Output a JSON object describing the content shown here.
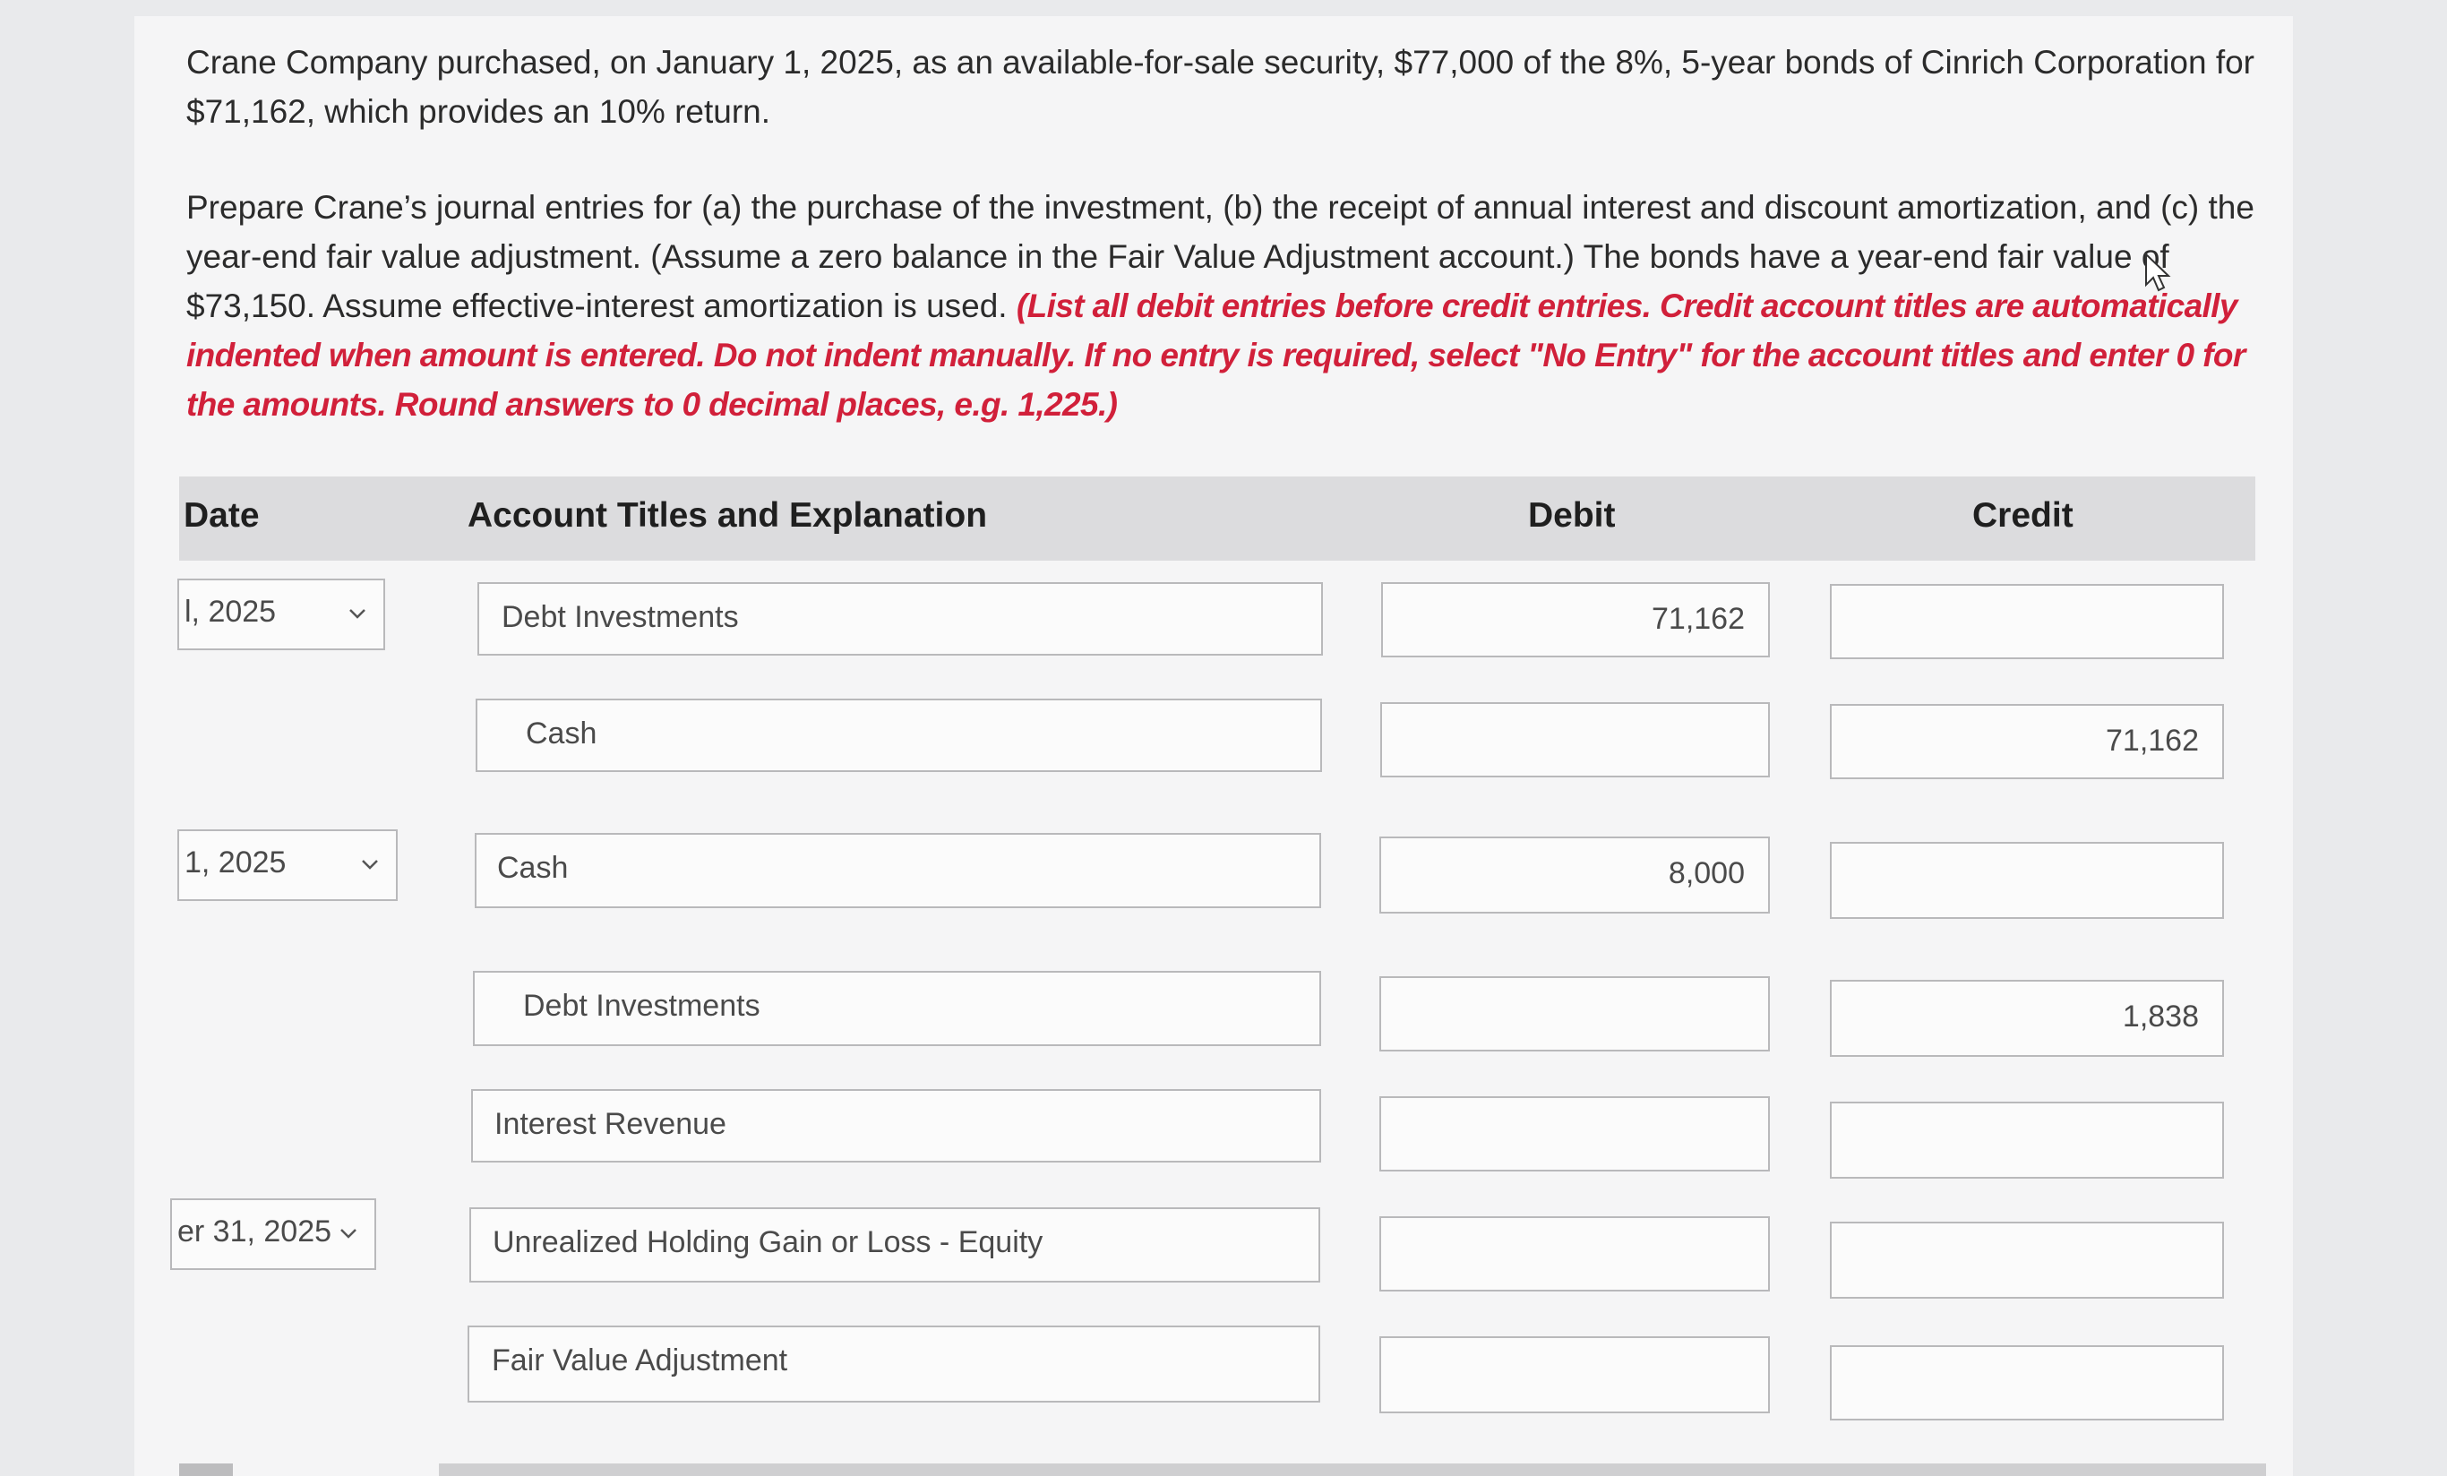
{
  "problem": {
    "paragraph1": "Crane Company purchased, on January 1, 2025, as an available-for-sale security, $77,000 of the 8%, 5-year bonds of Cinrich Corporation for $71,162, which provides an 10% return.",
    "paragraph2_plain": "Prepare Crane’s journal entries for (a) the purchase of the investment, (b) the receipt of annual interest and discount amortization, and (c) the year-end fair value adjustment. (Assume a zero balance in the Fair Value Adjustment account.) The bonds have a year-end fair value of $73,150. Assume effective-interest amortization is used. ",
    "paragraph2_instructions": "(List all debit entries before credit entries. Credit account titles are automatically indented when amount is entered. Do not indent manually. If no entry is required, select \"No Entry\" for the account titles and enter 0 for the amounts. Round answers to 0 decimal places, e.g. 1,225.)"
  },
  "table": {
    "headers": {
      "date": "Date",
      "account": "Account Titles and Explanation",
      "debit": "Debit",
      "credit": "Credit"
    },
    "dates": [
      "l, 2025",
      "1, 2025",
      "er 31, 2025"
    ],
    "rows": [
      {
        "account": "Debt Investments",
        "debit": "71,162",
        "credit": ""
      },
      {
        "account": "Cash",
        "debit": "",
        "credit": "71,162"
      },
      {
        "account": "Cash",
        "debit": "8,000",
        "credit": ""
      },
      {
        "account": "Debt Investments",
        "debit": "",
        "credit": "1,838"
      },
      {
        "account": "Interest Revenue",
        "debit": "",
        "credit": ""
      },
      {
        "account": "Unrealized Holding Gain or Loss - Equity",
        "debit": "",
        "credit": ""
      },
      {
        "account": "Fair Value Adjustment",
        "debit": "",
        "credit": ""
      }
    ]
  },
  "colors": {
    "instruction_red": "#d1203a",
    "header_bg": "#dcdcde",
    "field_border": "#b9b9bb"
  },
  "icons": [
    "chevron-down-icon",
    "mouse-pointer-icon"
  ]
}
